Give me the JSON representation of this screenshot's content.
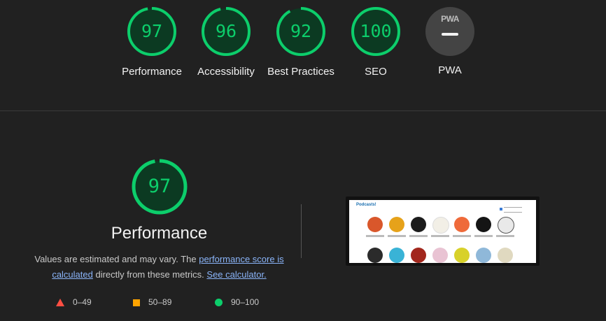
{
  "summary_gauges": [
    {
      "name": "performance",
      "score": "97",
      "label": "Performance",
      "fraction": 0.97
    },
    {
      "name": "accessibility",
      "score": "96",
      "label": "Accessibility",
      "fraction": 0.96
    },
    {
      "name": "best-practices",
      "score": "92",
      "label": "Best Practices",
      "fraction": 0.92
    },
    {
      "name": "seo",
      "score": "100",
      "label": "SEO",
      "fraction": 1.0
    },
    {
      "name": "pwa",
      "score": "",
      "label": "PWA",
      "badge": "PWA"
    }
  ],
  "performance_section": {
    "score": "97",
    "fraction": 0.97,
    "title": "Performance",
    "desc_prefix": "Values are estimated and may vary. The ",
    "desc_link1": "performance score is calculated",
    "desc_middle": " directly from these metrics. ",
    "desc_link2": "See calculator."
  },
  "legend": [
    {
      "range": "0–49",
      "shape": "triangle",
      "color": "#ff4e42"
    },
    {
      "range": "50–89",
      "shape": "square",
      "color": "#ffa400"
    },
    {
      "range": "90–100",
      "shape": "circle",
      "color": "#0cce6b"
    }
  ],
  "screenshot": {
    "heading": "Podcasts!"
  },
  "colors": {
    "pass": "#0cce6b",
    "background": "#212121",
    "link": "#8ab4f8"
  }
}
